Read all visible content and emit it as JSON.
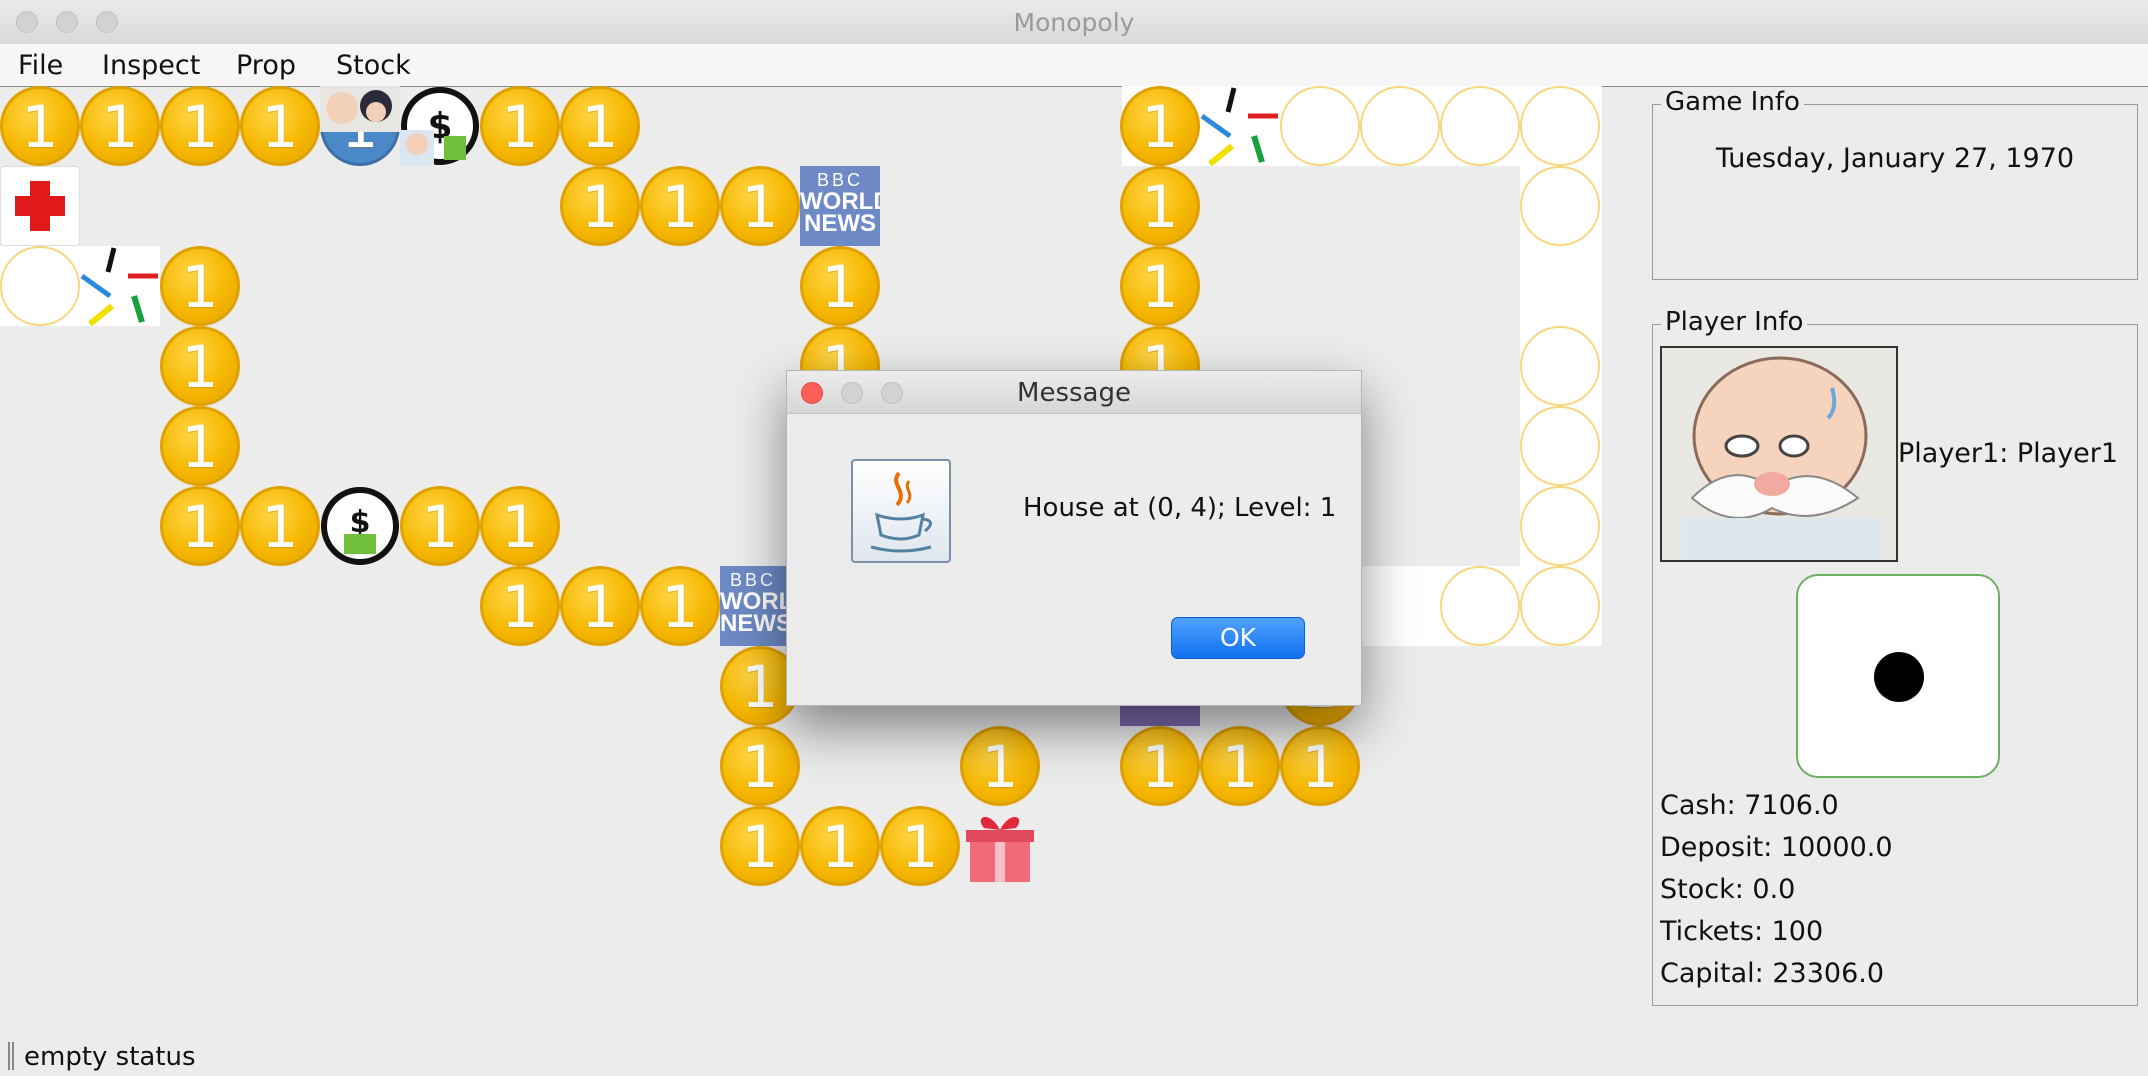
{
  "window": {
    "title": "Monopoly"
  },
  "menu": [
    "File",
    "Inspect",
    "Prop",
    "Stock"
  ],
  "board": {
    "coin_label": "1",
    "news_line1": "BBC",
    "news_line2": "WORLD",
    "news_line3": "NEWS",
    "news_cropped_line2": "WORLD",
    "news_cropped_line3": "NEWS"
  },
  "dialog": {
    "title": "Message",
    "message": "House at (0, 4); Level: 1",
    "ok_label": "OK",
    "icon": "java-icon"
  },
  "game_info": {
    "title": "Game Info",
    "date": "Tuesday, January 27, 1970"
  },
  "player_info": {
    "title": "Player Info",
    "name": "Player1: Player1",
    "dice_value": 1,
    "cash": "Cash: 7106.0",
    "deposit": "Deposit: 10000.0",
    "stock": "Stock: 0.0",
    "tickets": "Tickets: 100",
    "capital": "Capital: 23306.0"
  },
  "status": {
    "text": "empty status"
  },
  "colors": {
    "coin": "#f6b800",
    "ok_button": "#1170f0",
    "dice_border": "#6cb062",
    "news_tile": "#6d8ac6"
  }
}
